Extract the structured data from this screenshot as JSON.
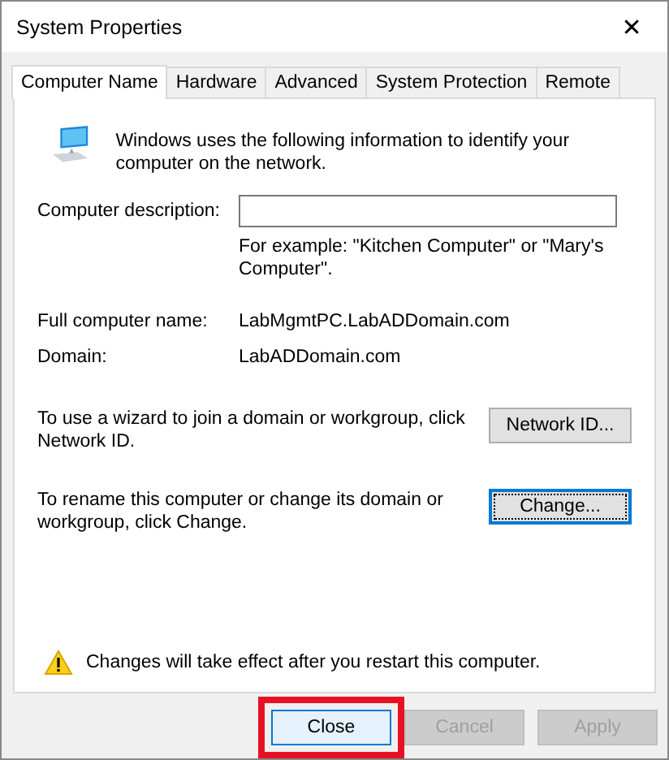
{
  "window": {
    "title": "System Properties",
    "close": "✕"
  },
  "tabs": [
    {
      "label": "Computer Name",
      "selected": true
    },
    {
      "label": "Hardware",
      "selected": false
    },
    {
      "label": "Advanced",
      "selected": false
    },
    {
      "label": "System Protection",
      "selected": false
    },
    {
      "label": "Remote",
      "selected": false
    }
  ],
  "intro": "Windows uses the following information to identify your computer on the network.",
  "description": {
    "label": "Computer description:",
    "hint": "For example: \"Kitchen Computer\" or \"Mary's Computer\"."
  },
  "info": [
    {
      "label": "Full computer name:",
      "value": "LabMgmtPC.LabADDomain.com"
    },
    {
      "label": "Domain:",
      "value": "LabADDomain.com"
    }
  ],
  "actions": [
    {
      "text": "To use a wizard to join a domain or workgroup, click Network ID.",
      "button": "Network ID...",
      "focused": false
    },
    {
      "text": "To rename this computer or change its domain or workgroup, click Change.",
      "button": "Change...",
      "focused": true
    }
  ],
  "notice": "Changes will take effect after you restart this computer.",
  "buttons": [
    {
      "label": "Close",
      "disabled": false,
      "highlighted": true
    },
    {
      "label": "Cancel",
      "disabled": true,
      "highlighted": false
    },
    {
      "label": "Apply",
      "disabled": true,
      "highlighted": false
    }
  ]
}
